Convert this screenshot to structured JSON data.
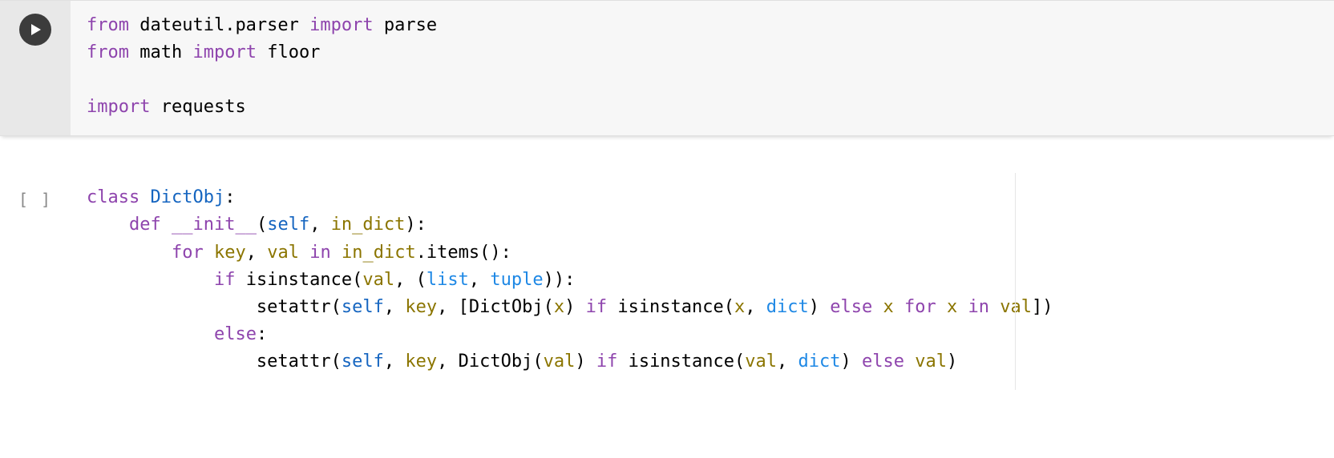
{
  "cells": [
    {
      "status": "active",
      "prompt": "run",
      "code_raw": "from dateutil.parser import parse\nfrom math import floor\n\nimport requests"
    },
    {
      "status": "idle",
      "prompt": "[ ]",
      "code_raw": "class DictObj:\n    def __init__(self, in_dict):\n        for key, val in in_dict.items():\n            if isinstance(val, (list, tuple)):\n                setattr(self, key, [DictObj(x) if isinstance(x, dict) else x for x in val])\n            else:\n                setattr(self, key, DictObj(val) if isinstance(val, dict) else val)"
    }
  ],
  "icons": {
    "run": "play"
  },
  "colors": {
    "keyword": "#8e44ad",
    "definition": "#1565c0",
    "variable": "#8b7500",
    "builtin_type": "#1e88e5",
    "gutter_active": "#e8e8e8",
    "cell_active": "#f7f7f7"
  }
}
